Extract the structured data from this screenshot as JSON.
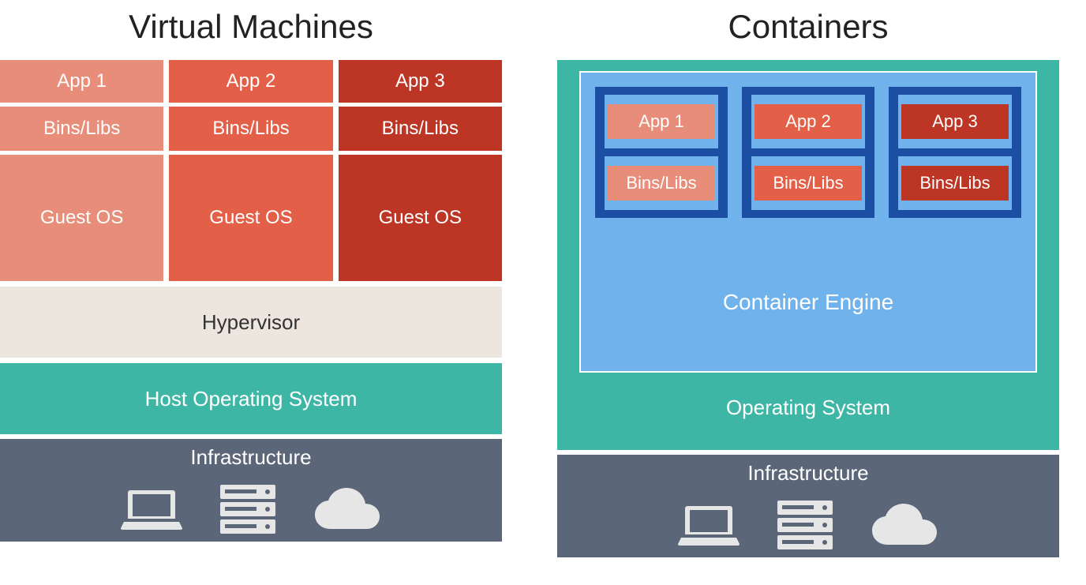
{
  "vm": {
    "title": "Virtual Machines",
    "cols": [
      {
        "app": "App 1",
        "libs": "Bins/Libs",
        "os": "Guest OS"
      },
      {
        "app": "App 2",
        "libs": "Bins/Libs",
        "os": "Guest OS"
      },
      {
        "app": "App 3",
        "libs": "Bins/Libs",
        "os": "Guest OS"
      }
    ],
    "hypervisor": "Hypervisor",
    "host_os": "Host Operating System",
    "infra": "Infrastructure"
  },
  "ct": {
    "title": "Containers",
    "engine": "Container Engine",
    "os": "Operating System",
    "infra": "Infrastructure",
    "shelves": [
      {
        "app": "App 1",
        "libs": "Bins/Libs"
      },
      {
        "app": "App 2",
        "libs": "Bins/Libs"
      },
      {
        "app": "App 3",
        "libs": "Bins/Libs"
      }
    ]
  },
  "icons": {
    "laptop": "laptop-icon",
    "server": "server-icon",
    "cloud": "cloud-icon"
  },
  "colors": {
    "shade1": "#e88d7a",
    "shade2": "#e45f47",
    "shade3": "#bc3525",
    "teal": "#3eb6a6",
    "beige": "#ece6df",
    "slate": "#5b6679",
    "blue": "#6fb2ec",
    "darkblue": "#1c4fa3"
  }
}
